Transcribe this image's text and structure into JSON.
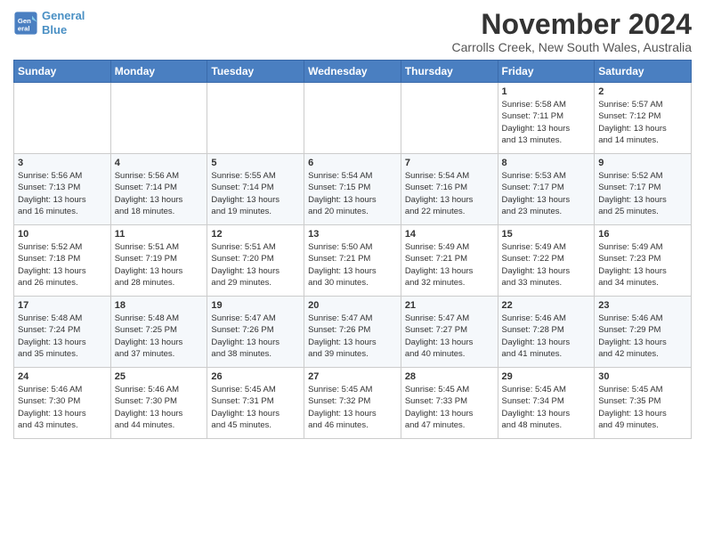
{
  "logo": {
    "line1": "General",
    "line2": "Blue"
  },
  "title": "November 2024",
  "location": "Carrolls Creek, New South Wales, Australia",
  "weekdays": [
    "Sunday",
    "Monday",
    "Tuesday",
    "Wednesday",
    "Thursday",
    "Friday",
    "Saturday"
  ],
  "weeks": [
    [
      {
        "day": "",
        "info": ""
      },
      {
        "day": "",
        "info": ""
      },
      {
        "day": "",
        "info": ""
      },
      {
        "day": "",
        "info": ""
      },
      {
        "day": "",
        "info": ""
      },
      {
        "day": "1",
        "info": "Sunrise: 5:58 AM\nSunset: 7:11 PM\nDaylight: 13 hours\nand 13 minutes."
      },
      {
        "day": "2",
        "info": "Sunrise: 5:57 AM\nSunset: 7:12 PM\nDaylight: 13 hours\nand 14 minutes."
      }
    ],
    [
      {
        "day": "3",
        "info": "Sunrise: 5:56 AM\nSunset: 7:13 PM\nDaylight: 13 hours\nand 16 minutes."
      },
      {
        "day": "4",
        "info": "Sunrise: 5:56 AM\nSunset: 7:14 PM\nDaylight: 13 hours\nand 18 minutes."
      },
      {
        "day": "5",
        "info": "Sunrise: 5:55 AM\nSunset: 7:14 PM\nDaylight: 13 hours\nand 19 minutes."
      },
      {
        "day": "6",
        "info": "Sunrise: 5:54 AM\nSunset: 7:15 PM\nDaylight: 13 hours\nand 20 minutes."
      },
      {
        "day": "7",
        "info": "Sunrise: 5:54 AM\nSunset: 7:16 PM\nDaylight: 13 hours\nand 22 minutes."
      },
      {
        "day": "8",
        "info": "Sunrise: 5:53 AM\nSunset: 7:17 PM\nDaylight: 13 hours\nand 23 minutes."
      },
      {
        "day": "9",
        "info": "Sunrise: 5:52 AM\nSunset: 7:17 PM\nDaylight: 13 hours\nand 25 minutes."
      }
    ],
    [
      {
        "day": "10",
        "info": "Sunrise: 5:52 AM\nSunset: 7:18 PM\nDaylight: 13 hours\nand 26 minutes."
      },
      {
        "day": "11",
        "info": "Sunrise: 5:51 AM\nSunset: 7:19 PM\nDaylight: 13 hours\nand 28 minutes."
      },
      {
        "day": "12",
        "info": "Sunrise: 5:51 AM\nSunset: 7:20 PM\nDaylight: 13 hours\nand 29 minutes."
      },
      {
        "day": "13",
        "info": "Sunrise: 5:50 AM\nSunset: 7:21 PM\nDaylight: 13 hours\nand 30 minutes."
      },
      {
        "day": "14",
        "info": "Sunrise: 5:49 AM\nSunset: 7:21 PM\nDaylight: 13 hours\nand 32 minutes."
      },
      {
        "day": "15",
        "info": "Sunrise: 5:49 AM\nSunset: 7:22 PM\nDaylight: 13 hours\nand 33 minutes."
      },
      {
        "day": "16",
        "info": "Sunrise: 5:49 AM\nSunset: 7:23 PM\nDaylight: 13 hours\nand 34 minutes."
      }
    ],
    [
      {
        "day": "17",
        "info": "Sunrise: 5:48 AM\nSunset: 7:24 PM\nDaylight: 13 hours\nand 35 minutes."
      },
      {
        "day": "18",
        "info": "Sunrise: 5:48 AM\nSunset: 7:25 PM\nDaylight: 13 hours\nand 37 minutes."
      },
      {
        "day": "19",
        "info": "Sunrise: 5:47 AM\nSunset: 7:26 PM\nDaylight: 13 hours\nand 38 minutes."
      },
      {
        "day": "20",
        "info": "Sunrise: 5:47 AM\nSunset: 7:26 PM\nDaylight: 13 hours\nand 39 minutes."
      },
      {
        "day": "21",
        "info": "Sunrise: 5:47 AM\nSunset: 7:27 PM\nDaylight: 13 hours\nand 40 minutes."
      },
      {
        "day": "22",
        "info": "Sunrise: 5:46 AM\nSunset: 7:28 PM\nDaylight: 13 hours\nand 41 minutes."
      },
      {
        "day": "23",
        "info": "Sunrise: 5:46 AM\nSunset: 7:29 PM\nDaylight: 13 hours\nand 42 minutes."
      }
    ],
    [
      {
        "day": "24",
        "info": "Sunrise: 5:46 AM\nSunset: 7:30 PM\nDaylight: 13 hours\nand 43 minutes."
      },
      {
        "day": "25",
        "info": "Sunrise: 5:46 AM\nSunset: 7:30 PM\nDaylight: 13 hours\nand 44 minutes."
      },
      {
        "day": "26",
        "info": "Sunrise: 5:45 AM\nSunset: 7:31 PM\nDaylight: 13 hours\nand 45 minutes."
      },
      {
        "day": "27",
        "info": "Sunrise: 5:45 AM\nSunset: 7:32 PM\nDaylight: 13 hours\nand 46 minutes."
      },
      {
        "day": "28",
        "info": "Sunrise: 5:45 AM\nSunset: 7:33 PM\nDaylight: 13 hours\nand 47 minutes."
      },
      {
        "day": "29",
        "info": "Sunrise: 5:45 AM\nSunset: 7:34 PM\nDaylight: 13 hours\nand 48 minutes."
      },
      {
        "day": "30",
        "info": "Sunrise: 5:45 AM\nSunset: 7:35 PM\nDaylight: 13 hours\nand 49 minutes."
      }
    ]
  ]
}
